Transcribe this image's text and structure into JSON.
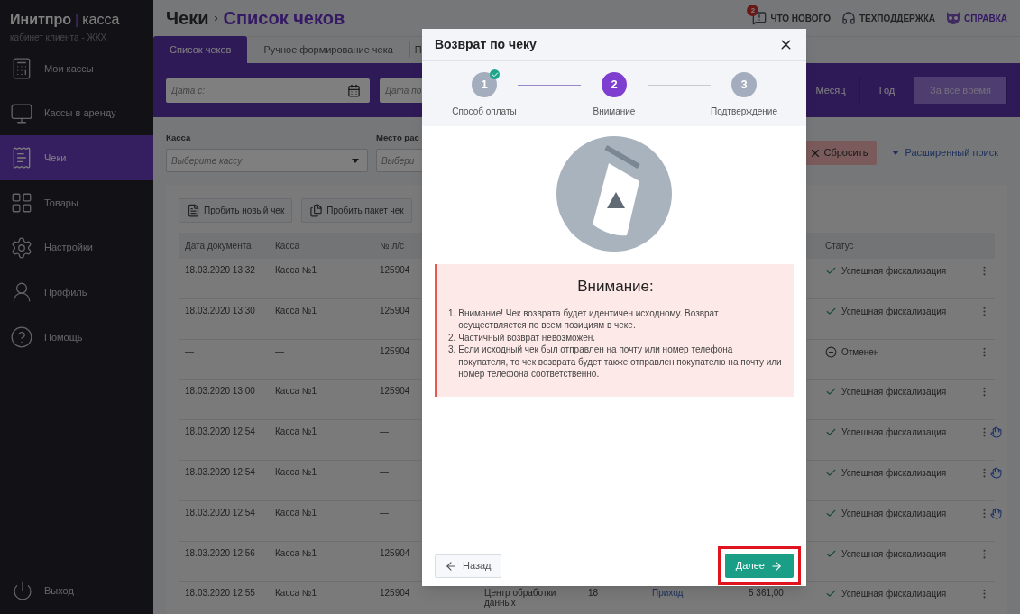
{
  "sidebar": {
    "logo": {
      "brand": "Инитпро",
      "divider": "|",
      "product": "касса"
    },
    "subtitle": "кабинет клиента - ЖКХ",
    "items": [
      {
        "kind": "registers",
        "label": "Мои кассы",
        "selected": false
      },
      {
        "kind": "rent",
        "label": "Кассы в аренду",
        "selected": false
      },
      {
        "kind": "receipts",
        "label": "Чеки",
        "selected": true
      },
      {
        "kind": "goods",
        "label": "Товары",
        "selected": false
      },
      {
        "kind": "settings",
        "label": "Настройки",
        "selected": false
      },
      {
        "kind": "profile",
        "label": "Профиль",
        "selected": false
      },
      {
        "kind": "help",
        "label": "Помощь",
        "selected": false
      }
    ],
    "logout": "Выход"
  },
  "header": {
    "breadcrumb": "Чеки",
    "separator": "›",
    "title": "Список чеков",
    "links": [
      {
        "kind": "news",
        "label": "ЧТО НОВОГО",
        "badge": "2"
      },
      {
        "kind": "support",
        "label": "ТЕХПОДДЕРЖКА"
      },
      {
        "kind": "help",
        "label": "СПРАВКА"
      }
    ]
  },
  "tabs": [
    {
      "label": "Список чеков",
      "selected": true
    },
    {
      "label": "Ручное формирование чека",
      "selected": false
    },
    {
      "label": "П",
      "selected": false
    }
  ],
  "date_filters": [
    {
      "placeholder": "Дата с:"
    },
    {
      "placeholder": "Дата по"
    }
  ],
  "periods": [
    {
      "label": "Месяц",
      "selected": false
    },
    {
      "label": "Год",
      "selected": false
    },
    {
      "label": "За все время",
      "selected": true
    }
  ],
  "filters": [
    {
      "label": "Касса",
      "placeholder": "Выберите кассу"
    },
    {
      "label": "Место рас",
      "placeholder": "Выбери"
    }
  ],
  "reset_button": "Сбросить",
  "advanced_search": "Расширенный поиск",
  "actions": [
    "Пробить новый чек",
    "Пробить пакет чек"
  ],
  "table": {
    "columns": [
      "Дата документа",
      "Касса",
      "№ л/с",
      "Статус"
    ],
    "rows": [
      {
        "date": "18.03.2020 13:32",
        "register": "Касса №1",
        "account": "125904",
        "kind": "success",
        "status": "Успешная фискализация",
        "hand": false
      },
      {
        "date": "18.03.2020 13:30",
        "register": "Касса №1",
        "account": "125904",
        "kind": "success",
        "status": "Успешная фискализация",
        "hand": false
      },
      {
        "date": "—",
        "register": "—",
        "account": "125904",
        "kind": "canceled",
        "status": "Отменен",
        "hand": false
      },
      {
        "date": "18.03.2020 13:00",
        "register": "Касса №1",
        "account": "125904",
        "kind": "success",
        "status": "Успешная фискализация",
        "hand": false
      },
      {
        "date": "18.03.2020 12:54",
        "register": "Касса №1",
        "account": "—",
        "kind": "success",
        "status": "Успешная фискализация",
        "hand": true
      },
      {
        "date": "18.03.2020 12:54",
        "register": "Касса №1",
        "account": "—",
        "kind": "success",
        "status": "Успешная фискализация",
        "hand": true
      },
      {
        "date": "18.03.2020 12:54",
        "register": "Касса №1",
        "account": "—",
        "kind": "success",
        "status": "Успешная фискализация",
        "hand": true
      },
      {
        "date": "18.03.2020 12:56",
        "register": "Касса №1",
        "account": "125904",
        "kind": "success",
        "status": "Успешная фискализация",
        "hand": false
      },
      {
        "date": "18.03.2020 12:55",
        "register": "Касса №1",
        "account": "125904",
        "column_4": "Центр обработки данных",
        "column_5": "18",
        "column_6": "Приход",
        "column_7": "5 361,00",
        "kind": "success",
        "status": "Успешная фискализация",
        "hand": false
      }
    ]
  },
  "dialog": {
    "title": "Возврат по чеку",
    "steps": [
      {
        "number": "1",
        "label": "Способ оплаты",
        "completed": true,
        "selected": false
      },
      {
        "number": "2",
        "label": "Внимание",
        "completed": false,
        "selected": true
      },
      {
        "number": "3",
        "label": "Подтверждение",
        "completed": false,
        "selected": false
      }
    ],
    "alert": {
      "title": "Внимание:",
      "items": [
        {
          "number": "1.",
          "text": "Внимание! Чек возврата будет идентичен исходному. Возврат осуществляется по всем позициям в чеке."
        },
        {
          "number": "2.",
          "text": "Частичный возврат невозможен."
        },
        {
          "number": "3.",
          "text": "Если исходный чек был отправлен на почту или номер телефона покупателя, то чек возврата будет также отправлен покупателю на почту или номер телефона соответственно."
        }
      ]
    },
    "back_button": "Назад",
    "next_button": "Далее",
    "next_highlighted": true
  }
}
